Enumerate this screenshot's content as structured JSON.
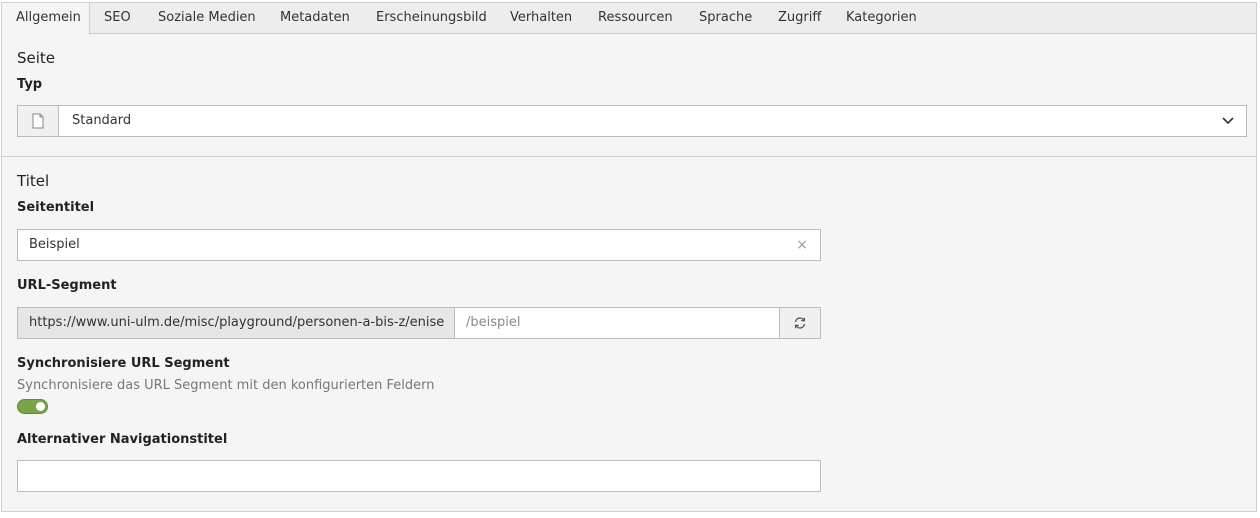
{
  "tabs": [
    {
      "label": "Allgemein",
      "active": true
    },
    {
      "label": "SEO"
    },
    {
      "label": "Soziale Medien"
    },
    {
      "label": "Metadaten"
    },
    {
      "label": "Erscheinungsbild"
    },
    {
      "label": "Verhalten"
    },
    {
      "label": "Ressourcen"
    },
    {
      "label": "Sprache"
    },
    {
      "label": "Zugriff"
    },
    {
      "label": "Kategorien"
    }
  ],
  "seite": {
    "section_title": "Seite",
    "typ_label": "Typ",
    "typ_value": "Standard",
    "typ_icon": "page-icon"
  },
  "titel": {
    "section_title": "Titel",
    "seitentitel_label": "Seitentitel",
    "seitentitel_value": "Beispiel",
    "url_segment_label": "URL-Segment",
    "url_prefix": "https://www.uni-ulm.de/misc/playground/personen-a-bis-z/enise",
    "url_segment_value": "/beispiel",
    "sync_label": "Synchronisiere URL Segment",
    "sync_description": "Synchronisiere das URL Segment mit den konfigurierten Feldern",
    "sync_enabled": true,
    "nav_title_label": "Alternativer Navigationstitel",
    "nav_title_value": ""
  },
  "colors": {
    "toggle_on": "#79a548",
    "tab_bar": "#ededed",
    "panel": "#f5f5f5"
  }
}
